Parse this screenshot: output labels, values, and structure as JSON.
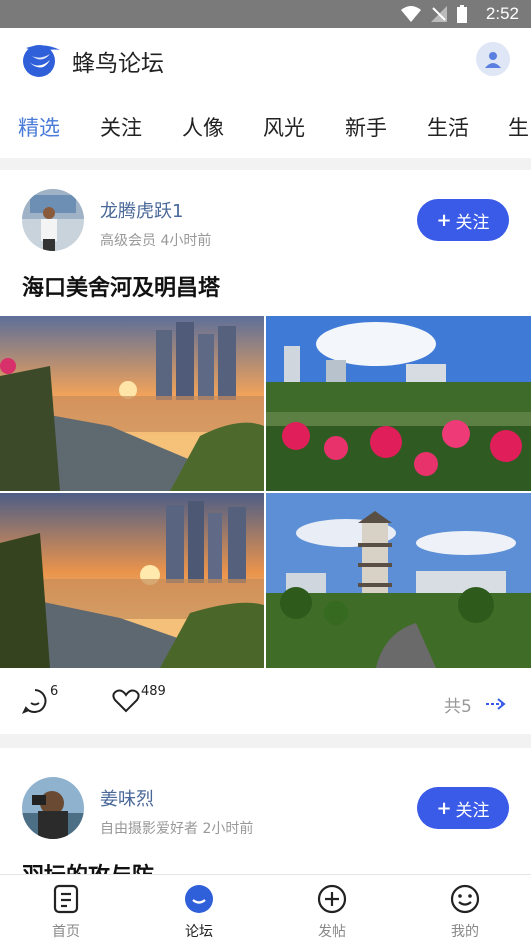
{
  "status_bar": {
    "time": "2:52"
  },
  "header": {
    "app_title": "蜂鸟论坛"
  },
  "tabs": [
    {
      "label": "精选",
      "active": true
    },
    {
      "label": "关注",
      "active": false
    },
    {
      "label": "人像",
      "active": false
    },
    {
      "label": "风光",
      "active": false
    },
    {
      "label": "新手",
      "active": false
    },
    {
      "label": "生活",
      "active": false
    },
    {
      "label": "生",
      "active": false
    }
  ],
  "posts": [
    {
      "author": "龙腾虎跃1",
      "meta": "高级会员 4小时前",
      "follow_label": "关注",
      "title": "海口美舍河及明昌塔",
      "comments": "6",
      "likes": "489",
      "total": "共5"
    },
    {
      "author": "姜味烈",
      "meta": "自由摄影爱好者 2小时前",
      "follow_label": "关注",
      "title": "羽坛的攻与防"
    }
  ],
  "bottom_nav": [
    {
      "label": "首页",
      "icon": "home-icon",
      "active": false
    },
    {
      "label": "论坛",
      "icon": "forum-icon",
      "active": true
    },
    {
      "label": "发帖",
      "icon": "plus-circle-icon",
      "active": false
    },
    {
      "label": "我的",
      "icon": "smiley-icon",
      "active": false
    }
  ],
  "colors": {
    "accent": "#3a5be8",
    "tab_active": "#4a7bd8",
    "author": "#4a6899"
  }
}
